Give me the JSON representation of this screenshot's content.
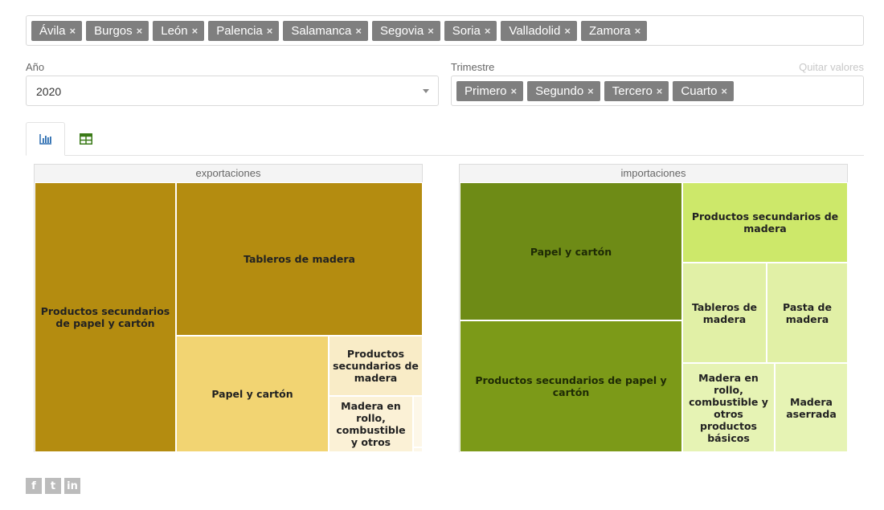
{
  "provinces": {
    "tags": [
      "Ávila",
      "Burgos",
      "León",
      "Palencia",
      "Salamanca",
      "Segovia",
      "Soria",
      "Valladolid",
      "Zamora"
    ],
    "remove_glyph": "×"
  },
  "year_field": {
    "label": "Año",
    "value": "2020"
  },
  "quarter_field": {
    "label": "Trimestre",
    "clear_label": "Quitar valores",
    "tags": [
      "Primero",
      "Segundo",
      "Tercero",
      "Cuarto"
    ]
  },
  "tabs": [
    {
      "icon": "bar-chart-icon",
      "active": true
    },
    {
      "icon": "table-icon",
      "active": false
    }
  ],
  "treemaps": {
    "exports": {
      "title": "exportaciones",
      "cells": [
        {
          "label": "Productos secundarios de papel y cartón",
          "color": "#b48c10"
        },
        {
          "label": "Tableros de madera",
          "color": "#b48c10"
        },
        {
          "label": "Papel y cartón",
          "color": "#f2d472"
        },
        {
          "label": "Productos secundarios de madera",
          "color": "#f9ecc7"
        },
        {
          "label": "Madera en rollo, combustible y otros",
          "color": "#fbf1d6"
        },
        {
          "label": "",
          "color": "#fdf7e8"
        },
        {
          "label": "",
          "color": "#fdf7e8"
        }
      ]
    },
    "imports": {
      "title": "importaciones",
      "cells": [
        {
          "label": "Papel y cartón",
          "color": "#6e8b16"
        },
        {
          "label": "Productos secundarios de papel y cartón",
          "color": "#7c9a18"
        },
        {
          "label": "Productos secundarios de madera",
          "color": "#cde86a"
        },
        {
          "label": "Tableros de madera",
          "color": "#e1f0a6"
        },
        {
          "label": "Pasta de madera",
          "color": "#e1f0a6"
        },
        {
          "label": "Madera en rollo, combustible y otros productos básicos",
          "color": "#e6f3b4"
        },
        {
          "label": "Madera aserrada",
          "color": "#e6f3b4"
        }
      ]
    }
  },
  "social": [
    {
      "icon": "facebook-icon",
      "glyph": "f"
    },
    {
      "icon": "twitter-icon",
      "glyph": "t"
    },
    {
      "icon": "linkedin-icon",
      "glyph": "in"
    }
  ]
}
